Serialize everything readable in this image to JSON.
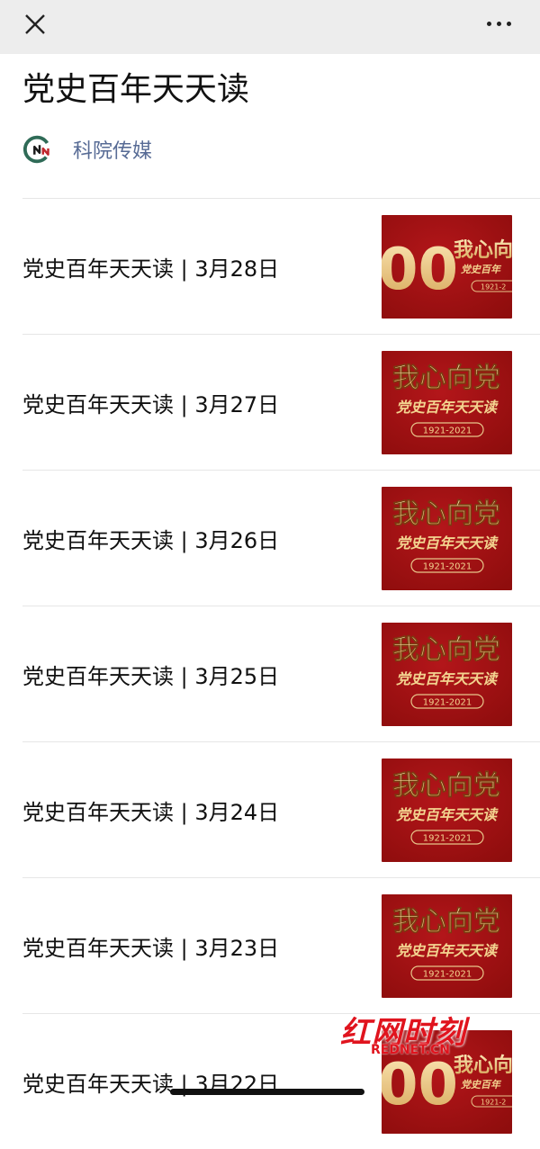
{
  "page": {
    "title": "党史百年天天读"
  },
  "account": {
    "name": "科院传媒",
    "logo_icon": "kyc-logo-icon"
  },
  "articles": [
    {
      "title": "党史百年天天读 | 3月28日",
      "thumb_variant": "100"
    },
    {
      "title": "党史百年天天读 | 3月27日",
      "thumb_variant": "heart"
    },
    {
      "title": "党史百年天天读 | 3月26日",
      "thumb_variant": "heart"
    },
    {
      "title": "党史百年天天读 | 3月25日",
      "thumb_variant": "heart"
    },
    {
      "title": "党史百年天天读 | 3月24日",
      "thumb_variant": "heart"
    },
    {
      "title": "党史百年天天读 | 3月23日",
      "thumb_variant": "heart"
    },
    {
      "title": "党史百年天天读 | 3月22日",
      "thumb_variant": "100"
    }
  ],
  "thumbnail": {
    "headline": "我心向党",
    "subline": "党史百年天天读",
    "years": "1921-2021",
    "number": "00",
    "headline_partial": "我心向",
    "subline_partial": "党史百年",
    "years_partial": "1921-2"
  },
  "watermark": {
    "brand": "红网时刻",
    "url": "REDNET.CN"
  },
  "colors": {
    "link": "#576b95",
    "thumb_red": "#8f0d0d",
    "gold": "#e6c27a",
    "watermark_red": "#e0141e"
  }
}
